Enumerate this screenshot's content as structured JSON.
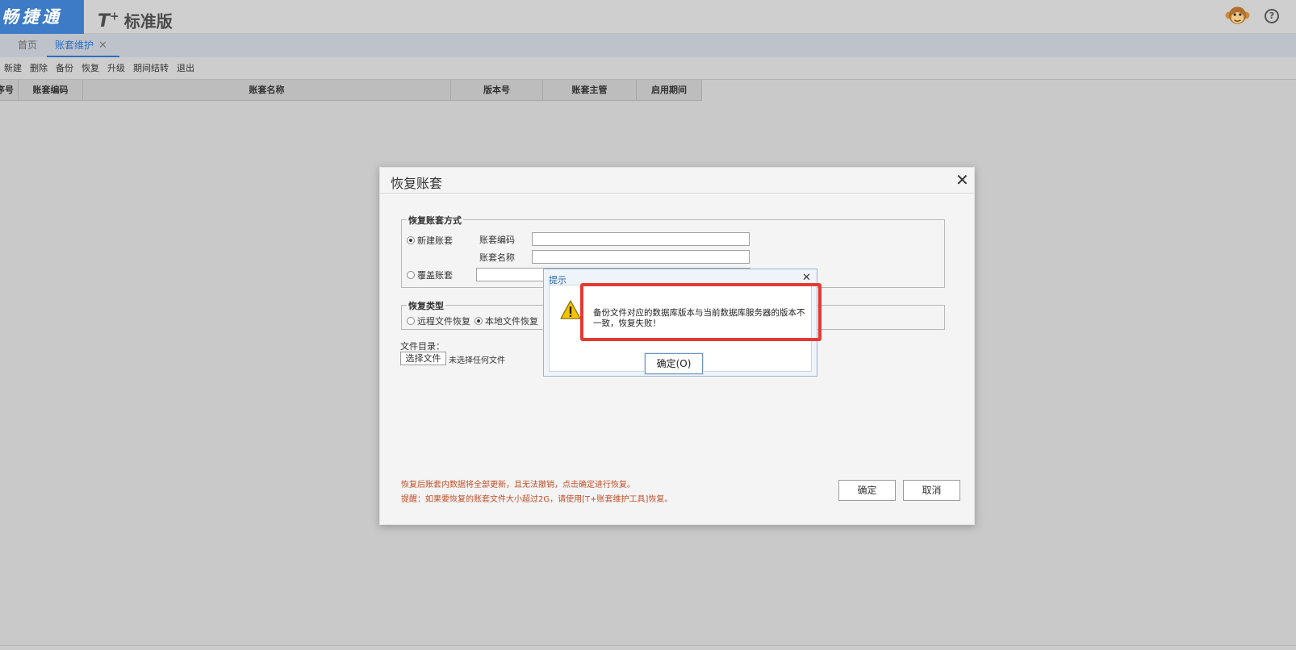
{
  "header": {
    "brand": "畅捷通",
    "product_prefix": "T",
    "product_plus": "+",
    "product_name": "标准版",
    "help_glyph": "?"
  },
  "tabs": {
    "home": "首页",
    "active": "账套维护",
    "close_glyph": "✕"
  },
  "toolbar": [
    "新建",
    "删除",
    "备份",
    "恢复",
    "升级",
    "期间结转",
    "退出"
  ],
  "table": {
    "columns": [
      "序号",
      "账套编码",
      "账套名称",
      "版本号",
      "账套主管",
      "启用期间"
    ]
  },
  "dialog": {
    "title": "恢复账套",
    "close_glyph": "✕",
    "restore_method": {
      "legend": "恢复账套方式",
      "new_option": "新建账套",
      "overwrite_option": "覆盖账套",
      "code_label": "账套编码",
      "name_label": "账套名称",
      "code_value": "",
      "name_value": "",
      "selected": "new"
    },
    "restore_type": {
      "legend": "恢复类型",
      "remote_option": "远程文件恢复",
      "local_option": "本地文件恢复",
      "selected": "local"
    },
    "file_dir_label": "文件目录：",
    "choose_file_button": "选择文件",
    "no_file_text": "未选择任何文件",
    "note1": "恢复后账套内数据将全部更新，且无法撤销，点击确定进行恢复。",
    "note2": "提醒：如果要恢复的账套文件大小超过2G，请使用[T+账套维护工具]恢复。",
    "ok_button": "确定",
    "cancel_button": "取消"
  },
  "alert": {
    "title": "提示",
    "close_glyph": "✕",
    "icon": "warning-icon",
    "message": "备份文件对应的数据库版本与当前数据库服务器的版本不一致，恢复失败！",
    "ok_button": "确定(O)"
  },
  "colors": {
    "brand": "#3d7bc7",
    "active_tab": "#2f6fc2",
    "note_text": "#c0502a",
    "highlight": "#e23a34"
  }
}
